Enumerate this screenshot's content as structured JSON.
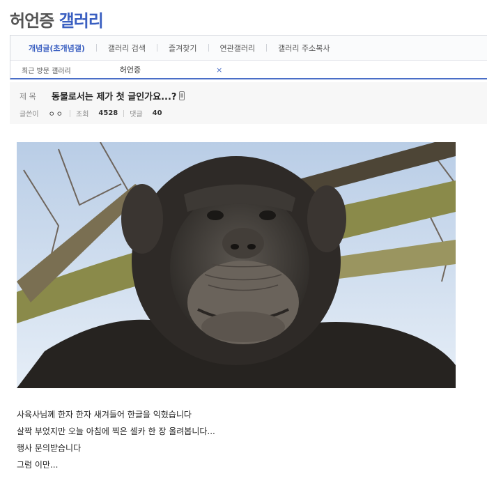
{
  "gallery": {
    "title_part1": "허언증",
    "title_part2": "갤러리"
  },
  "nav": {
    "tabs": [
      {
        "label": "개념글(초개념갤)",
        "active": true
      },
      {
        "label": "갤러리 검색",
        "active": false
      },
      {
        "label": "즐겨찾기",
        "active": false
      },
      {
        "label": "연관갤러리",
        "active": false
      },
      {
        "label": "갤러리 주소복사",
        "active": false
      }
    ],
    "recent": {
      "label": "최근 방문 갤러리",
      "item": "허언증",
      "close": "×"
    }
  },
  "post": {
    "subject_label": "제 목",
    "subject": "동물로서는 제가 첫 글인가요...?",
    "author_label": "글쓴이",
    "author": "ㅇㅇ",
    "views_label": "조회",
    "views": "4528",
    "comments_label": "댓글",
    "comments": "40",
    "image_alt": "chimpanzee-selfie-photo",
    "body_lines": [
      "사육사님께 한자 한자 새겨들어 한글을 익혔습니다",
      "살짝 부었지만 오늘 아침에 찍은 셀카 한 장 올려봅니다...",
      "행사 문의받습니다",
      "그럼 이만..."
    ]
  },
  "colors": {
    "accent": "#3a5fc1",
    "nav_border": "#4a6ec7",
    "header_bg": "#f7f7f7"
  }
}
